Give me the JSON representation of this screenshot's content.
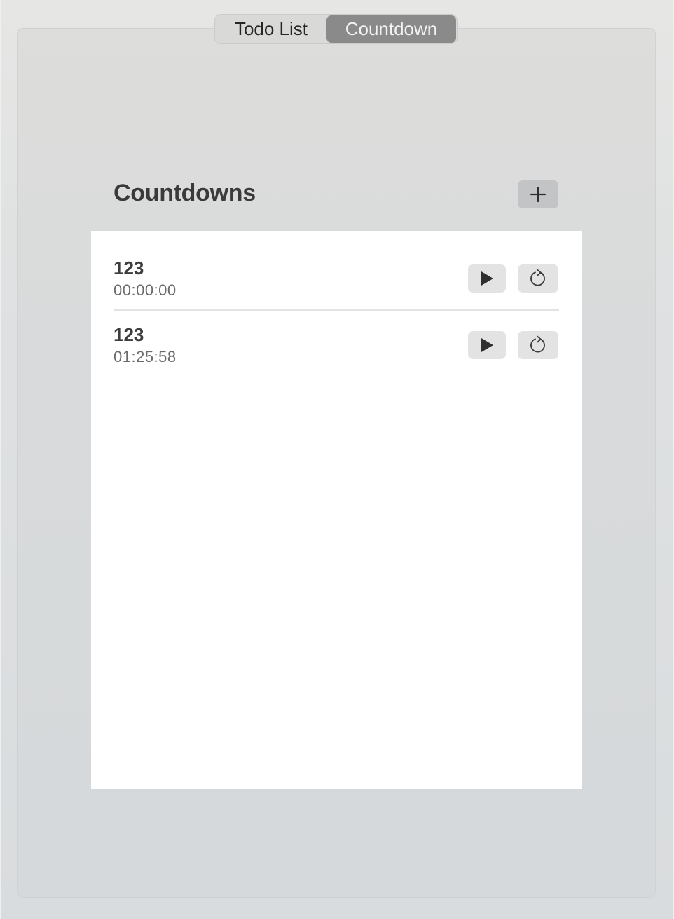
{
  "tabs": [
    {
      "label": "Todo List",
      "selected": false
    },
    {
      "label": "Countdown",
      "selected": true
    }
  ],
  "main": {
    "title": "Countdowns",
    "add_icon": "plus-icon"
  },
  "countdowns": [
    {
      "name": "123",
      "time": "00:00:00",
      "play_icon": "play-icon",
      "reset_icon": "reset-icon"
    },
    {
      "name": "123",
      "time": "01:25:58",
      "play_icon": "play-icon",
      "reset_icon": "reset-icon"
    }
  ],
  "colors": {
    "selected_tab": "#8a8a8a",
    "panel_background": "#ffffff",
    "button_background": "#e3e3e3"
  }
}
